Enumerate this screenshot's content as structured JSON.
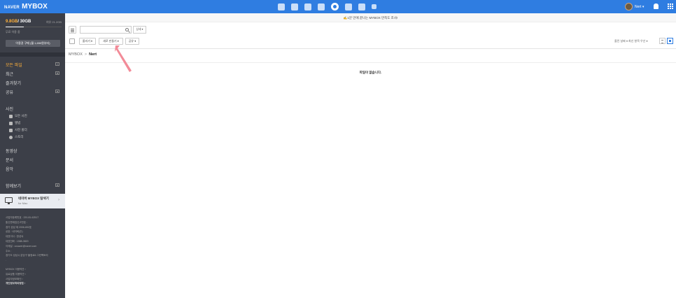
{
  "header": {
    "brand_naver": "NAVER",
    "brand_mybox": "MYBOX",
    "apps": [
      "mail-icon",
      "calendar-icon",
      "list-icon",
      "contacts-icon",
      "mybox-icon",
      "memo-icon",
      "keep-icon",
      "more-icon"
    ],
    "user_name": "Nert ▾"
  },
  "sidebar": {
    "used": "9.8GB",
    "total": "/ 30GB",
    "remaining": "여유 21.2GB",
    "usage_fraction": 0.33,
    "free_label": "무료 이용 중",
    "buy_button": "이용권 구매 (월 1,650원부터)",
    "nav": [
      {
        "label": "모든 파일",
        "plus": "+"
      },
      {
        "label": "최근",
        "plus": "▾"
      },
      {
        "label": "즐겨찾기",
        "plus": ""
      },
      {
        "label": "공유",
        "plus": "▾"
      }
    ],
    "photo_section": "사진",
    "photo_items": [
      "모든 사진",
      "앨범",
      "사진 폴더",
      "스토리"
    ],
    "media_items": [
      "동영상",
      "문서",
      "음악"
    ],
    "view_more": "함께보기",
    "view_more_plus": "▾",
    "mac_title": "네이버 MYBOX 탐색기",
    "mac_sub": "for Mac",
    "footer_lines": [
      "사업자등록번호 : 220-81-62517",
      "통신판매업신고번호 :",
      "경기 성남 제 2006-692호",
      "상호 : 네이버(주)",
      "대표이사 : 한성숙",
      "대표전화 : 1588-3820",
      "이메일 : ccsaver@naver.com",
      "주소 :",
      "경기도 성남시 분당구 불정로6 그린팩토리",
      "."
    ],
    "footer_links": [
      "MYBOX 이용약관 ›",
      "유료상품 이용약관 ›",
      "사업자정보확인 ›",
      "개인정보처리방침 ›"
    ]
  },
  "main": {
    "notice_icon": "✍",
    "notice": "1분 만에 끝나는 MYBOX 만족도 조사!",
    "search_placeholder": "",
    "detail_btn": "상세 ▾",
    "upload_btn": "올리기 ▾",
    "new_btn": "새로 만들기 ▾",
    "share_btn": "공유 ▾",
    "sort_label": "올린 날짜 ▾  최신 항목 우선 ▾",
    "breadcrumb_root": "MYBOX",
    "breadcrumb_sep": ">",
    "breadcrumb_current": "Nert",
    "empty_message": "파일이 없습니다."
  }
}
